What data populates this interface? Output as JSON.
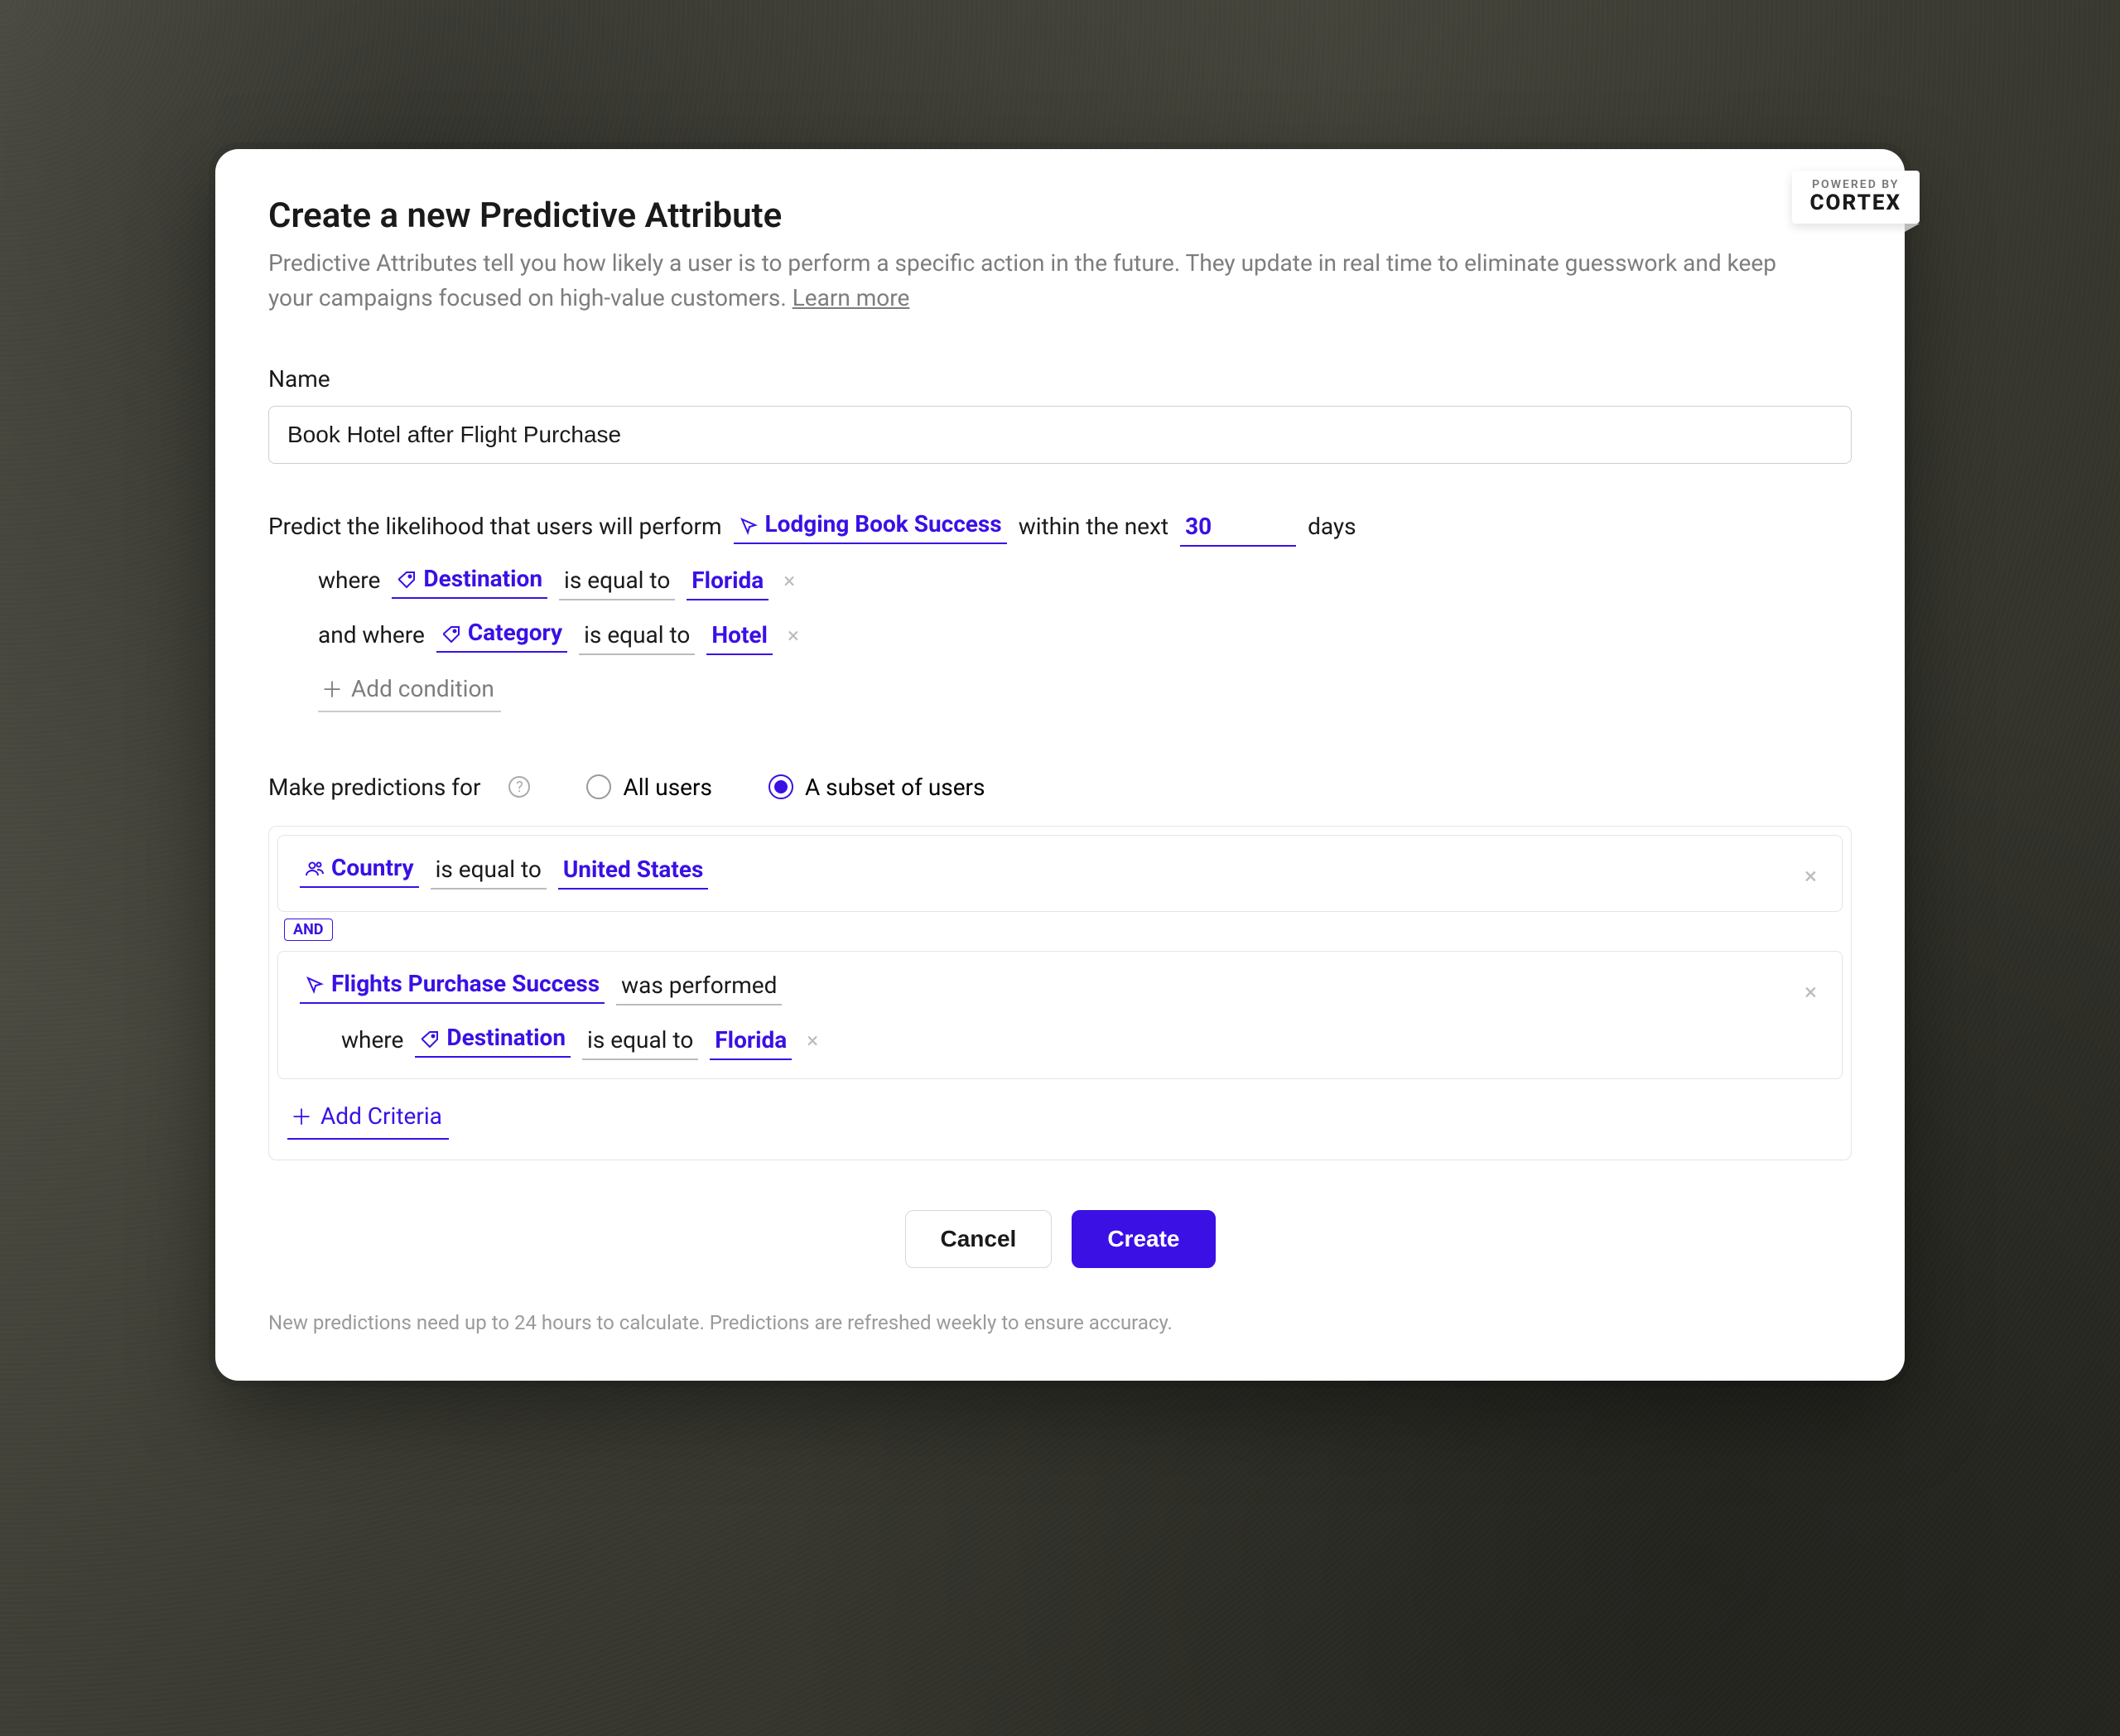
{
  "badge": {
    "powered_by": "POWERED BY",
    "brand": "CORTEX"
  },
  "header": {
    "title": "Create a new Predictive Attribute",
    "description": "Predictive Attributes tell you how likely a user is to perform a specific action in the future. They update in real time to eliminate guesswork and keep your campaigns focused on high-value customers. ",
    "learn_more": "Learn more"
  },
  "name": {
    "label": "Name",
    "value": "Book Hotel after Flight Purchase"
  },
  "predict": {
    "prefix": "Predict the likelihood that users will perform",
    "event": "Lodging Book Success",
    "middle": "within the next",
    "days_value": "30",
    "days_suffix": "days"
  },
  "conditions": [
    {
      "prefix": "where",
      "attr": "Destination",
      "op": "is equal to",
      "value": "Florida"
    },
    {
      "prefix": "and where",
      "attr": "Category",
      "op": "is equal to",
      "value": "Hotel"
    }
  ],
  "add_condition": "Add condition",
  "predictions_for": {
    "label": "Make predictions for",
    "option_all": "All users",
    "option_subset": "A subset of users",
    "selected": "subset"
  },
  "subset": {
    "block1": {
      "attr": "Country",
      "op": "is equal to",
      "value": "United States"
    },
    "and_chip": "AND",
    "block2": {
      "event": "Flights Purchase Success",
      "op": "was performed",
      "nested": {
        "prefix": "where",
        "attr": "Destination",
        "op": "is equal to",
        "value": "Florida"
      }
    }
  },
  "add_criteria": "Add Criteria",
  "buttons": {
    "cancel": "Cancel",
    "create": "Create"
  },
  "footnote": "New predictions need up to 24 hours to calculate. Predictions are refreshed weekly to ensure accuracy."
}
